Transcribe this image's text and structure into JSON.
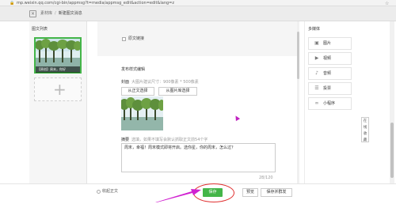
{
  "browser": {
    "url": "mp.weixin.qq.com/cgi-bin/appmsg?t=media/appmsg_edit&action=edit&lang=z"
  },
  "topbar": {
    "close_glyph": "×",
    "breadcrumb": [
      "素材库",
      "新建图文消息"
    ]
  },
  "left_panel": {
    "title": "图文列表",
    "articles": [
      {
        "caption": "【原创】周末，你好"
      }
    ]
  },
  "editor": {
    "original_link_label": "原文链接",
    "publish_style_label": "发布样式编辑",
    "cover_label": "封面",
    "cover_hint": "大图片建议尺寸：900像素 * 500像素",
    "from_body_button": "从正文选择",
    "from_library_button": "从图片库选择",
    "summary_label": "摘要",
    "summary_hint": "选填，如果不填写会默认抓取正文前54个字",
    "summary_text": "周末，幸福！周末模式即将开启。选你星，你的周末，怎么过？",
    "summary_count": "28/120"
  },
  "right_panel": {
    "title": "多媒体",
    "items": [
      {
        "icon": "image-icon",
        "label": "图片"
      },
      {
        "icon": "video-icon",
        "label": "视频"
      },
      {
        "icon": "audio-icon",
        "label": "音频"
      },
      {
        "icon": "vote-icon",
        "label": "投票"
      },
      {
        "icon": "mini-program-icon",
        "label": "小程序"
      }
    ],
    "collapse_tab": [
      "在",
      "线",
      "收",
      "藏"
    ]
  },
  "bottombar": {
    "collect_label": "收起正文",
    "save_button": "保存",
    "preview_button": "预览",
    "send_button": "保存并群发"
  },
  "colors": {
    "accent": "#44b549",
    "annotation": "#e03030",
    "arrow": "#d020d0"
  }
}
